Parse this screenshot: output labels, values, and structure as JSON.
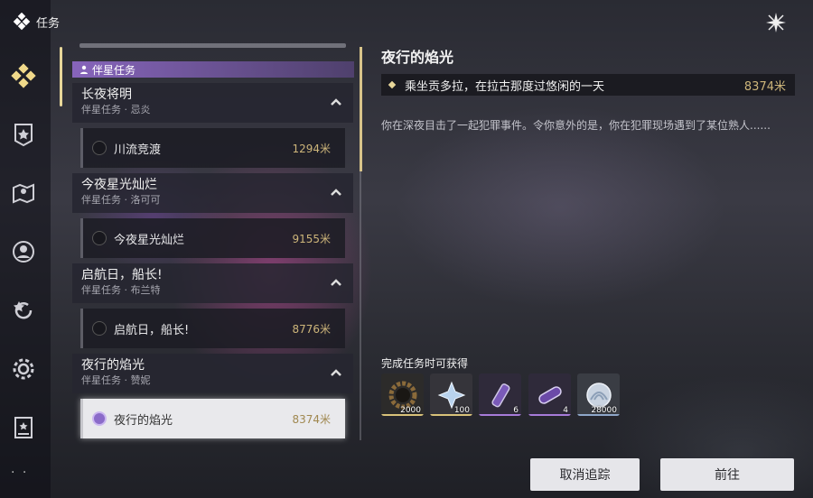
{
  "header": {
    "title": "任务"
  },
  "rail": {
    "items": [
      {
        "icon": "diamond-cluster-icon",
        "active": true
      },
      {
        "icon": "shield-banner-icon",
        "active": false
      },
      {
        "icon": "map-pin-icon",
        "active": false
      },
      {
        "icon": "companion-icon",
        "active": false
      },
      {
        "icon": "star-refresh-icon",
        "active": false
      },
      {
        "icon": "gear-icon",
        "active": false
      },
      {
        "icon": "card-icon",
        "active": false
      }
    ],
    "more": "· ·"
  },
  "list": {
    "category": "伴星任务",
    "groups": [
      {
        "title": "长夜将明",
        "sub": "伴星任务 · 忌炎",
        "task": "川流竞渡",
        "dist": "1294米"
      },
      {
        "title": "今夜星光灿烂",
        "sub": "伴星任务 · 洛可可",
        "task": "今夜星光灿烂",
        "dist": "9155米"
      },
      {
        "title": "启航日，船长!",
        "sub": "伴星任务 · 布兰特",
        "task": "启航日，船长!",
        "dist": "8776米"
      },
      {
        "title": "夜行的焰光",
        "sub": "伴星任务 · 赞妮",
        "task": "夜行的焰光",
        "dist": "8374米"
      }
    ]
  },
  "detail": {
    "title": "夜行的焰光",
    "objective": "乘坐贡多拉，在拉古那度过悠闲的一天",
    "objective_dist": "8374米",
    "description": "你在深夜目击了一起犯罪事件。令你意外的是，你在犯罪现场遇到了某位熟人......"
  },
  "rewards": {
    "label": "完成任务时可获得",
    "items": [
      {
        "icon": "gear-coin-icon",
        "qty": "2000",
        "edge": "#d9c27a"
      },
      {
        "icon": "crystal-star-icon",
        "qty": "100",
        "edge": "#d9c27a"
      },
      {
        "icon": "potion-tube-icon",
        "qty": "6",
        "edge": "#a77bd9"
      },
      {
        "icon": "capsule-icon",
        "qty": "4",
        "edge": "#a77bd9"
      },
      {
        "icon": "shell-coin-icon",
        "qty": "28000",
        "edge": "#8fa7c9"
      }
    ]
  },
  "buttons": {
    "untrack": "取消追踪",
    "go": "前往"
  }
}
